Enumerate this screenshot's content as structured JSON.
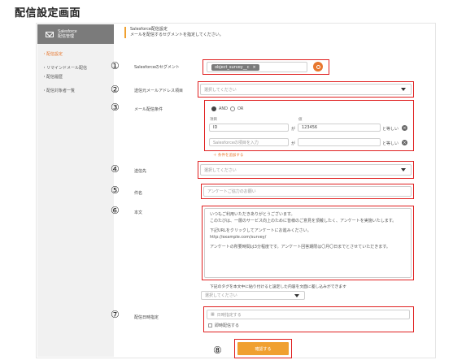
{
  "page_title": "配信設定画面",
  "sidebar": {
    "header": {
      "line1": "Salesforce",
      "line2": "配信管理"
    },
    "items": [
      {
        "label": "・配信設定",
        "active": true
      },
      {
        "label": "・リマインドメール配信",
        "active": false
      },
      {
        "label": "・配信履歴",
        "active": false
      },
      {
        "label": "・配信対象者一覧",
        "active": false
      }
    ]
  },
  "header": {
    "title": "Salesforce配信設定",
    "subtitle": "メールを配信するセグメントを指定してください。"
  },
  "markers": [
    "①",
    "②",
    "③",
    "④",
    "⑤",
    "⑥",
    "⑦",
    "⑧"
  ],
  "segment": {
    "label": "Salesforceのセグメント",
    "chip": "object_survey__c",
    "chip_close": "×",
    "search_icon": "search-icon"
  },
  "sender": {
    "label": "送信元メールアドレス項目",
    "placeholder": "選択してください"
  },
  "conditions": {
    "label": "メール配信条件",
    "and_label": "AND",
    "or_label": "OR",
    "col_item": "項目",
    "col_value": "値",
    "rows": [
      {
        "item": "ID",
        "ga": "が",
        "value": "123456",
        "op": "と等しい"
      },
      {
        "item": "Salesforceの項目を入力",
        "ga": "が",
        "value": "",
        "op": "と等しい"
      }
    ],
    "add_link": "＋ 条件を追加する"
  },
  "recipient": {
    "label": "送信先",
    "placeholder": "選択してください"
  },
  "subject": {
    "label": "件名",
    "value": "アンケートご協力のお願い"
  },
  "body": {
    "label": "本文",
    "lines": [
      "いつもご利用いただきありがとうございます。",
      "このたびは、一層のサービス向上のために皆様のご意見を頂戴したく、アンケートを実施いたします。",
      "下記URLをクリックしてアンケートにお進みください。",
      "http://example.com/survey/",
      "アンケートの所要時間は3分程度です。アンケート回答期限は〇月〇日までとさせていただきます。"
    ],
    "hint": "下記のタグを本文中に貼り付けると設定した内容を文面に差し込みができます",
    "tag_select": "選択してください"
  },
  "schedule": {
    "label": "配信日時指定",
    "placeholder": "日時指定する",
    "checkbox_label": "即時配信する"
  },
  "submit_label": "確認する",
  "colors": {
    "accent": "#f0a030",
    "highlight": "#e02020",
    "sidebar_header": "#7b7b7b"
  }
}
